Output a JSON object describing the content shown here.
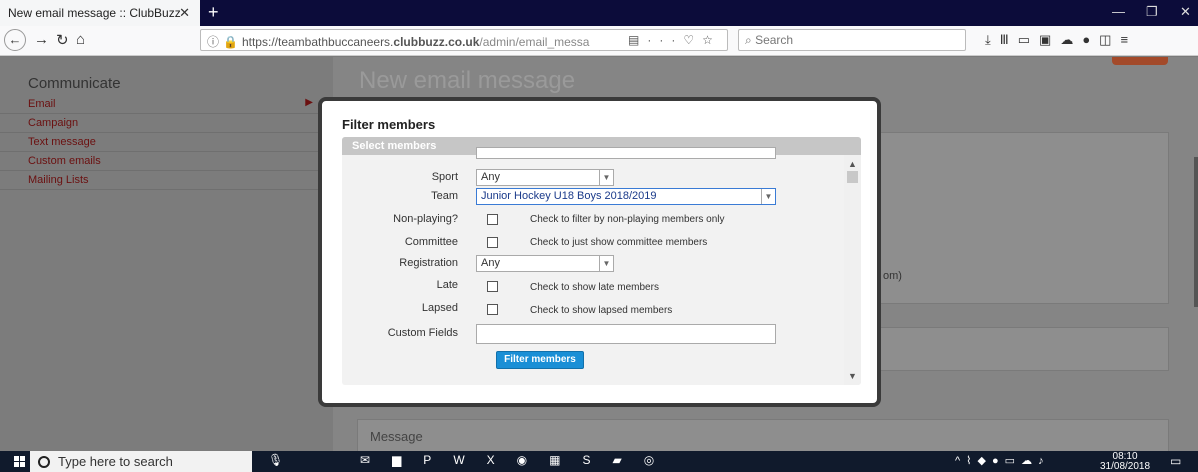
{
  "browser": {
    "tab_title": "New email message :: ClubBuzz",
    "tab_close": "✕",
    "new_tab": "+",
    "url_host": "https://teambathbuccaneers.",
    "url_domain": "clubbuzz.co.uk",
    "url_path": "/admin/email_messa",
    "url_more": "···",
    "search_placeholder": "Search"
  },
  "sidebar": {
    "title": "Communicate",
    "items": [
      {
        "label": "Email"
      },
      {
        "label": "Campaign"
      },
      {
        "label": "Text message"
      },
      {
        "label": "Custom emails"
      },
      {
        "label": "Mailing Lists"
      }
    ]
  },
  "main": {
    "page_title": "New email message",
    "partial_text": "om)",
    "message_label": "Message"
  },
  "modal": {
    "title": "Filter members",
    "section_header": "Select members",
    "sport_label": "Sport",
    "sport_value": "Any",
    "team_label": "Team",
    "team_value": "Junior Hockey U18 Boys 2018/2019",
    "nonplaying_label": "Non-playing?",
    "nonplaying_text": "Check to filter by non-playing members only",
    "committee_label": "Committee",
    "committee_text": "Check to just show committee members",
    "registration_label": "Registration",
    "registration_value": "Any",
    "late_label": "Late",
    "late_text": "Check to show late members",
    "lapsed_label": "Lapsed",
    "lapsed_text": "Check to show lapsed members",
    "custom_fields_label": "Custom Fields",
    "custom_fields_value": "",
    "filter_button": "Filter members"
  },
  "taskbar": {
    "search_placeholder": "Type here to search",
    "time": "08:10",
    "date": "31/08/2018"
  }
}
